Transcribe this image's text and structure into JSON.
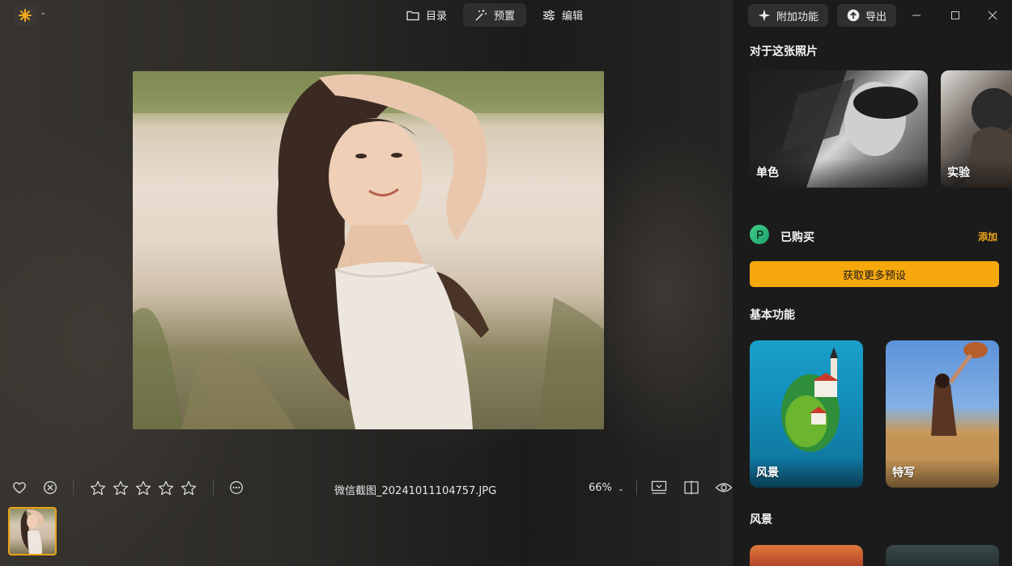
{
  "nav": {
    "tabs": [
      {
        "label": "目录",
        "icon": "folder-icon",
        "active": false
      },
      {
        "label": "预置",
        "icon": "magic-wand-icon",
        "active": true
      },
      {
        "label": "编辑",
        "icon": "sliders-icon",
        "active": false
      }
    ]
  },
  "header": {
    "addons_label": "附加功能",
    "export_label": "导出"
  },
  "viewer": {
    "filename": "微信截图_20241011104757.JPG",
    "zoom": "66%",
    "rating": 0,
    "max_rating": 5
  },
  "panel": {
    "about_title": "对于这张照片",
    "about_cards": [
      {
        "label": "单色"
      },
      {
        "label": "实验"
      }
    ],
    "purchased_label": "已购买",
    "add_label": "添加",
    "get_more_label": "获取更多预设",
    "basic_title": "基本功能",
    "basic_cards": [
      {
        "label": "风景"
      },
      {
        "label": "特写"
      }
    ],
    "landscape_title": "风景"
  },
  "colors": {
    "accent": "#f7a80d",
    "panel_bg": "#1b1b1b",
    "purchased_badge": "#2fbf7e"
  }
}
